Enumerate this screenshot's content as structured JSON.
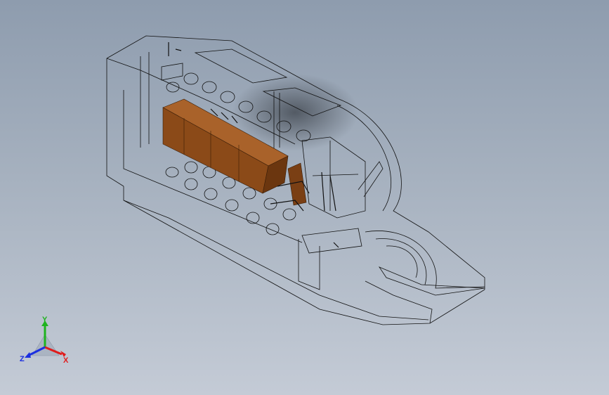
{
  "triad": {
    "x_label": "X",
    "y_label": "Y",
    "z_label": "Z",
    "x_color": "#e01b1b",
    "y_color": "#1fb31f",
    "z_color": "#1b2fe0"
  },
  "model": {
    "wire_color": "#111111",
    "component_color": "#8b4a18",
    "component_shade": "#6b360f",
    "component_light": "#a9622a"
  }
}
